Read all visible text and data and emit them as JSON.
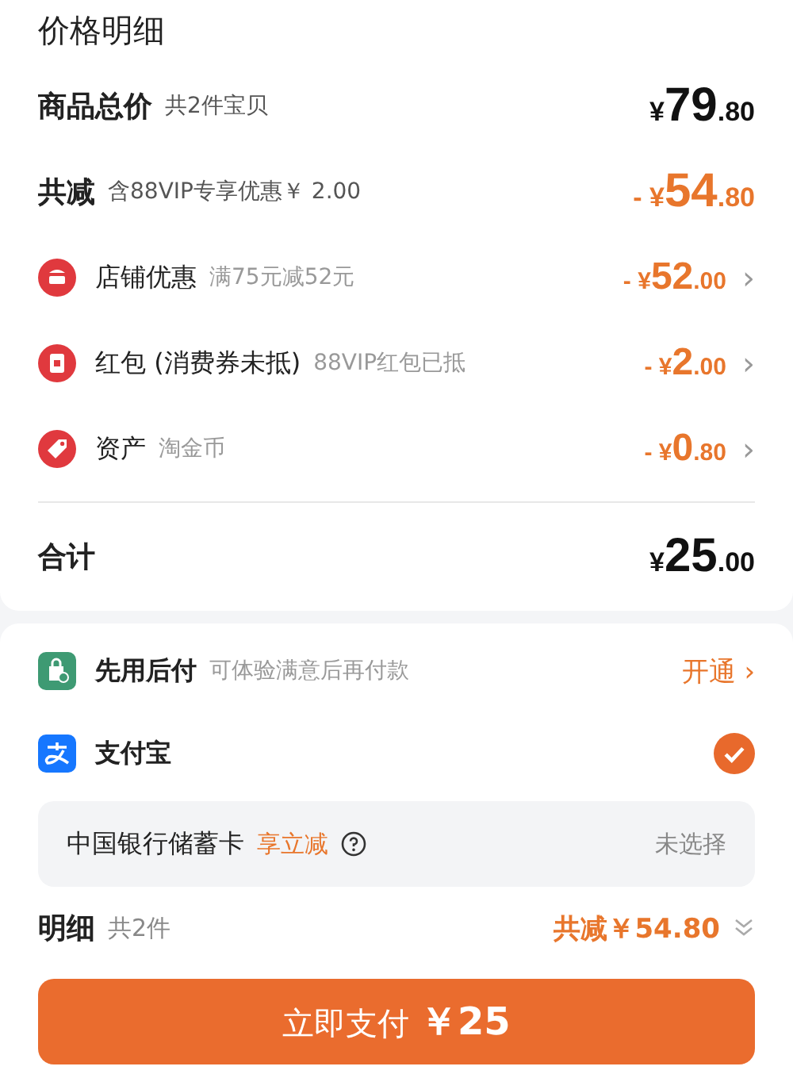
{
  "title": "价格明细",
  "summary": [
    {
      "label": "商品总价",
      "note": "共2件宝贝",
      "amount": {
        "prefix": "¥",
        "integer": "79",
        "decimal": ".80"
      },
      "kind": "total"
    },
    {
      "label": "共减",
      "note": "含88VIP专享优惠￥ 2.00",
      "amount": {
        "prefix": "- ¥",
        "integer": "54",
        "decimal": ".80"
      },
      "kind": "discount"
    }
  ],
  "discounts": [
    {
      "kind": "shop",
      "label": "店铺优惠",
      "note": "满75元减52元",
      "amount": {
        "prefix": "- ¥",
        "integer": "52",
        "decimal": ".00"
      },
      "chevron": "›"
    },
    {
      "kind": "redpacket",
      "label": "红包 (消费券未抵)",
      "note": "88VIP红包已抵",
      "amount": {
        "prefix": "- ¥",
        "integer": "2",
        "decimal": ".00"
      },
      "chevron": "›"
    },
    {
      "kind": "asset",
      "label": "资产",
      "note": "淘金币",
      "amount": {
        "prefix": "- ¥",
        "integer": "0",
        "decimal": ".80"
      },
      "chevron": "›"
    }
  ],
  "total": {
    "label": "合计",
    "amount": {
      "prefix": "¥",
      "integer": "25",
      "decimal": ".00"
    }
  },
  "payment_methods": [
    {
      "kind": "paylater",
      "label": "先用后付",
      "note": "可体验满意后再付款",
      "action": "开通 ›"
    },
    {
      "kind": "alipay",
      "label": "支付宝",
      "selected": true
    }
  ],
  "bank_card": {
    "label": "中国银行储蓄卡",
    "promo": "享立减",
    "status": "未选择"
  },
  "detail": {
    "label": "明细",
    "count": "共2件",
    "saving": "共减￥54.80"
  },
  "pay_button": {
    "label": "立即支付",
    "amount": "￥25"
  }
}
